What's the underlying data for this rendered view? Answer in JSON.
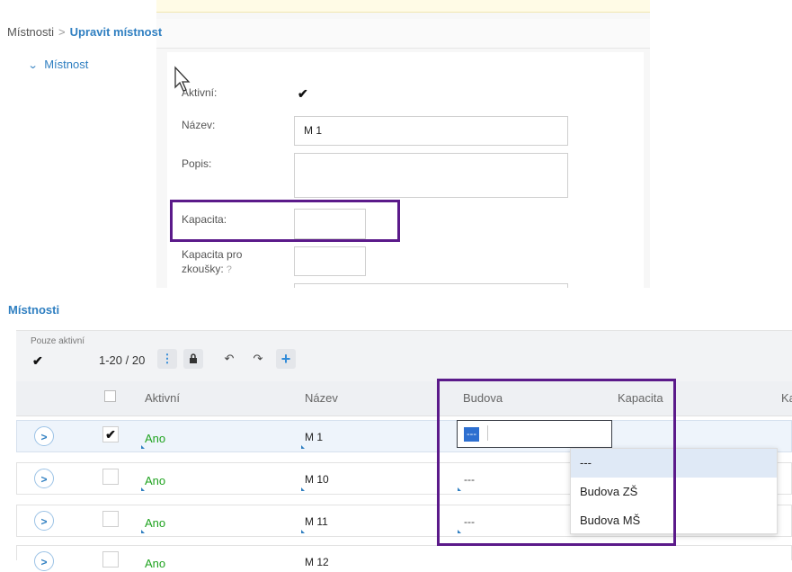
{
  "breadcrumb": {
    "parent": "Místnosti",
    "separator": ">",
    "current": "Upravit místnost"
  },
  "section": {
    "title": "Místnost",
    "chevron": "chevron-down-icon"
  },
  "form": {
    "active_label": "Aktivní:",
    "active_checked": true,
    "name_label": "Název:",
    "name_value": "M 1",
    "desc_label": "Popis:",
    "desc_value": "",
    "capacity_label": "Kapacita:",
    "capacity_value": "",
    "exam_capacity_label_1": "Kapacita pro",
    "exam_capacity_label_2": "zkoušky:",
    "help_mark": "?"
  },
  "grid": {
    "title": "Místnosti",
    "filter_label": "Pouze aktivní",
    "filter_checked": true,
    "range": "1-20 / 20",
    "columns": [
      "Aktivní",
      "Název",
      "Budova",
      "Kapacita",
      "Ka"
    ],
    "rows": [
      {
        "active": "Ano",
        "name": "M 1",
        "building": "---",
        "checked": true,
        "selected": true
      },
      {
        "active": "Ano",
        "name": "M 10",
        "building": "---",
        "checked": false,
        "selected": false
      },
      {
        "active": "Ano",
        "name": "M 11",
        "building": "---",
        "checked": false,
        "selected": false
      },
      {
        "active": "Ano",
        "name": "M 12",
        "building": "",
        "checked": false,
        "selected": false
      }
    ],
    "editor_value": "---",
    "dropdown_options": [
      "---",
      "Budova ZŠ",
      "Budova MŠ"
    ],
    "dropdown_highlighted": "---"
  },
  "icons": {
    "menu": "⋮",
    "lock": "🔒",
    "undo": "↶",
    "redo": "↷",
    "add": "+",
    "expand": ">",
    "check": "✔"
  },
  "colors": {
    "accent": "#2f7fc1",
    "active_text": "#1fa31f",
    "annotation": "#5b1a8a"
  }
}
